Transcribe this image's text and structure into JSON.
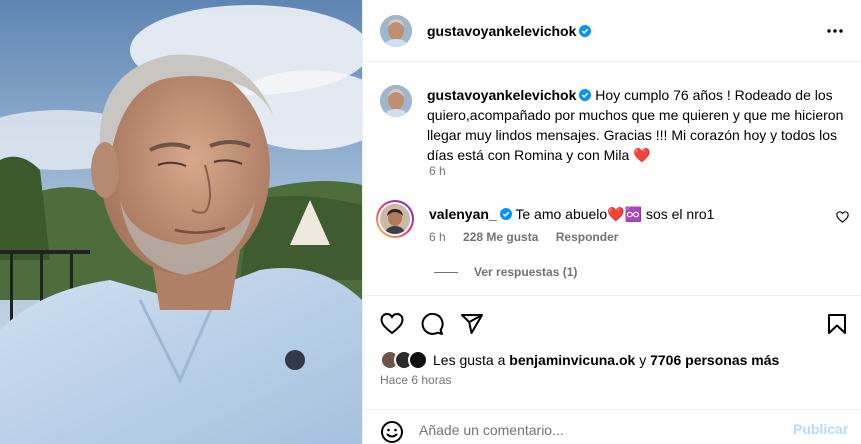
{
  "post": {
    "author": "gustavoyankelevichok",
    "caption_text": "Hoy cumplo 76 años ! Rodeado de los quiero,acompañado por muchos que me quieren y que me hicieron llegar muy lindos mensajes. Gracias !!! Mi corazón hoy y todos los días está con Romina y con Mila",
    "caption_emoji": "❤️",
    "caption_time": "6 h"
  },
  "comment": {
    "author": "valenyan_",
    "text": "Te amo abuelo",
    "emoji_text": "❤️♾️ sos el nro1",
    "time": "6 h",
    "likes": "228 Me gusta",
    "reply_label": "Responder",
    "view_replies": "Ver respuestas (1)"
  },
  "likes": {
    "prefix": "Les gusta a",
    "user": "benjaminvicuna.ok",
    "joiner": "y",
    "others": "7706 personas más",
    "time_ago": "Hace 6 horas"
  },
  "add_comment": {
    "placeholder": "Añade un comentario...",
    "publish_label": "Publicar"
  },
  "icons": {
    "verified": "verified-badge-icon",
    "more": "more-options-icon",
    "like": "heart-icon",
    "comment": "comment-bubble-icon",
    "share": "paper-plane-icon",
    "save": "bookmark-icon",
    "emoji": "emoji-smiley-icon"
  },
  "colors": {
    "verified": "#0095f6",
    "secondary_text": "#737373",
    "publish_disabled": "#b3dbff",
    "heart_red": "#ed4956"
  }
}
